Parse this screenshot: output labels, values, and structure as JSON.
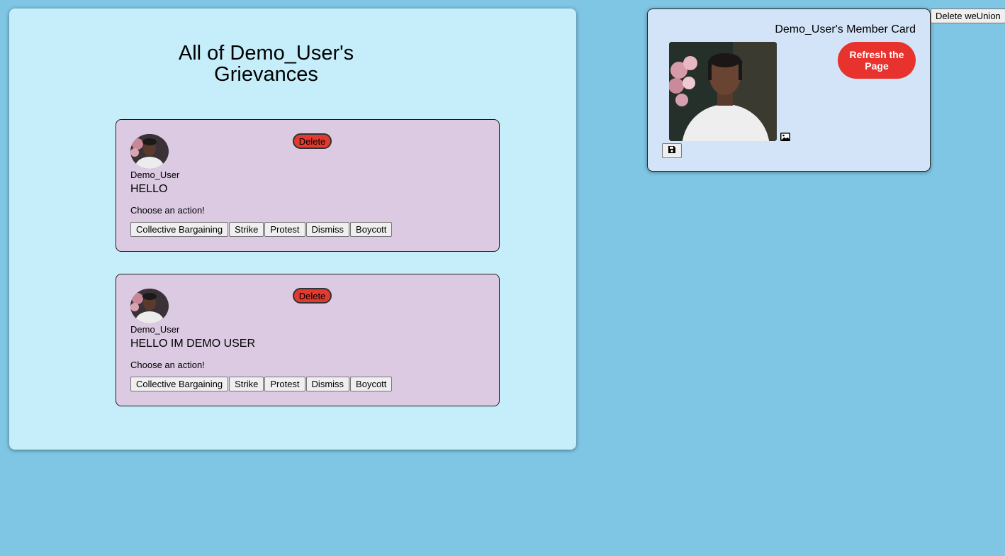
{
  "page": {
    "title": "All of Demo_User's Grievances"
  },
  "grievances": [
    {
      "username": "Demo_User",
      "message": "HELLO",
      "delete_label": "Delete",
      "prompt": "Choose an action!",
      "actions": [
        "Collective Bargaining",
        "Strike",
        "Protest",
        "Dismiss",
        "Boycott"
      ]
    },
    {
      "username": "Demo_User",
      "message": "HELLO IM DEMO USER",
      "delete_label": "Delete",
      "prompt": "Choose an action!",
      "actions": [
        "Collective Bargaining",
        "Strike",
        "Protest",
        "Dismiss",
        "Boycott"
      ]
    }
  ],
  "member_card": {
    "title": "Demo_User's Member Card",
    "refresh_label": "Refresh the Page",
    "save_icon": "save-icon",
    "image_icon": "image-icon"
  },
  "top_right": {
    "delete_weunion_label": "Delete weUnion"
  },
  "colors": {
    "background": "#7fc6e4",
    "panel": "#c5eefa",
    "card": "#dccae3",
    "member_card": "#d4e4f8",
    "delete_red": "#e23a2e",
    "refresh_red": "#e8322e"
  }
}
